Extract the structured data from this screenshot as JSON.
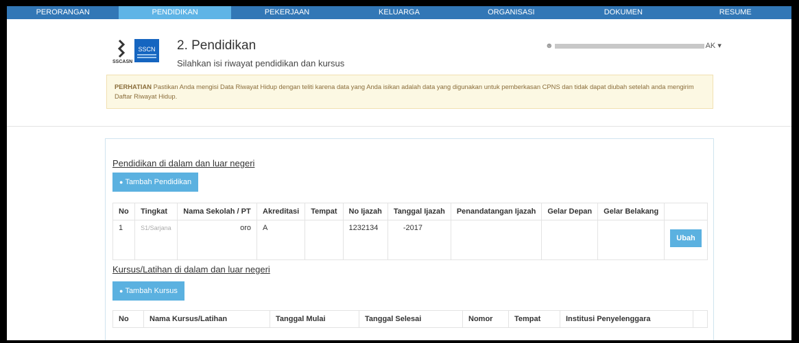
{
  "nav": {
    "items": [
      "PERORANGAN",
      "PENDIDIKAN",
      "PEKERJAAN",
      "KELUARGA",
      "ORGANISASI",
      "DOKUMEN",
      "RESUME"
    ],
    "active_index": 1
  },
  "header": {
    "logo_text": "SSCN",
    "logo_sub": "SSCASN",
    "title": "2. Pendidikan",
    "subtitle": "Silahkan isi riwayat pendidikan dan kursus",
    "user_suffix": "AK"
  },
  "alert": {
    "label": "PERHATIAN",
    "text": "Pastikan Anda mengisi Data Riwayat Hidup dengan teliti karena data yang Anda isikan adalah data yang digunakan untuk pemberkasan CPNS dan tidak dapat diubah setelah anda mengirim Daftar Riwayat Hidup."
  },
  "education": {
    "section_title": "Pendidikan di dalam dan luar negeri",
    "add_button": "Tambah Pendidikan",
    "columns": [
      "No",
      "Tingkat",
      "Nama Sekolah / PT",
      "Akreditasi",
      "Tempat",
      "No Ijazah",
      "Tanggal Ijazah",
      "Penandatangan Ijazah",
      "Gelar Depan",
      "Gelar Belakang",
      ""
    ],
    "rows": [
      {
        "no": "1",
        "tingkat": "S1/Sarjana",
        "nama": "oro",
        "akreditasi": "A",
        "tempat": "",
        "no_ijazah": "1232134",
        "tanggal": "-2017",
        "penandatangan": "",
        "gelar_depan": "",
        "gelar_belakang": "",
        "action": "Ubah"
      }
    ]
  },
  "courses": {
    "section_title": "Kursus/Latihan di dalam dan luar negeri",
    "add_button": "Tambah Kursus",
    "columns": [
      "No",
      "Nama Kursus/Latihan",
      "Tanggal Mulai",
      "Tanggal Selesai",
      "Nomor",
      "Tempat",
      "Institusi Penyelenggara",
      ""
    ]
  }
}
